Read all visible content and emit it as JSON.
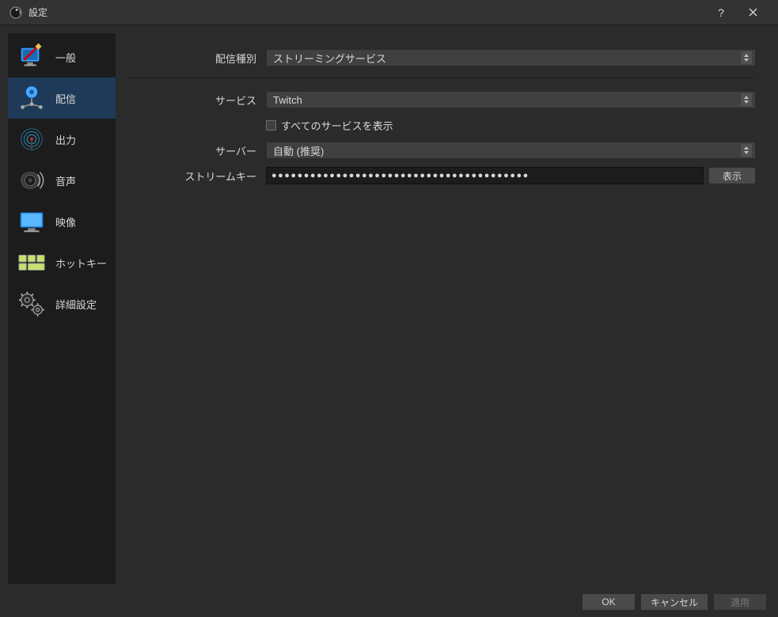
{
  "window": {
    "title": "設定"
  },
  "sidebar": {
    "items": [
      {
        "label": "一般",
        "icon": "general"
      },
      {
        "label": "配信",
        "icon": "stream",
        "active": true
      },
      {
        "label": "出力",
        "icon": "output"
      },
      {
        "label": "音声",
        "icon": "audio"
      },
      {
        "label": "映像",
        "icon": "video"
      },
      {
        "label": "ホットキー",
        "icon": "hotkey"
      },
      {
        "label": "詳細設定",
        "icon": "advanced"
      }
    ]
  },
  "form": {
    "stream_type_label": "配信種別",
    "stream_type_value": "ストリーミングサービス",
    "service_label": "サービス",
    "service_value": "Twitch",
    "show_all_label": "すべてのサービスを表示",
    "show_all_checked": false,
    "server_label": "サーバー",
    "server_value": "自動 (推奨)",
    "stream_key_label": "ストリームキー",
    "stream_key_value": "●●●●●●●●●●●●●●●●●●●●●●●●●●●●●●●●●●●●●●●●",
    "show_button": "表示"
  },
  "footer": {
    "ok": "OK",
    "cancel": "キャンセル",
    "apply": "適用"
  }
}
